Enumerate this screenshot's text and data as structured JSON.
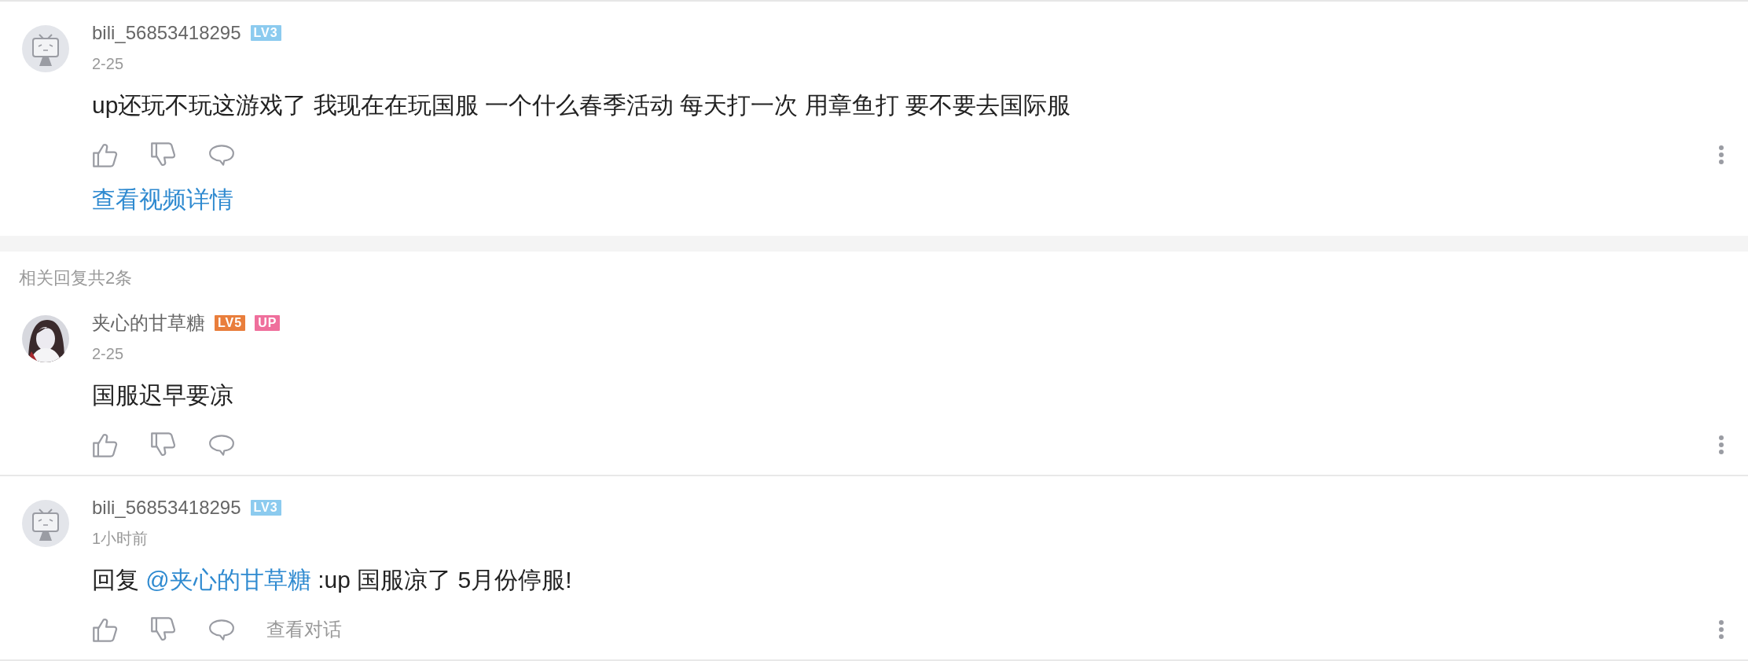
{
  "main_comment": {
    "avatar": {
      "kind": "default"
    },
    "user": "bili_56853418295",
    "badges": [
      {
        "text": "LV3",
        "color": "#8ccbef"
      }
    ],
    "date": "2-25",
    "text": "up还玩不玩这游戏了 我现在在玩国服 一个什么春季活动 每天打一次 用章鱼打 要不要去国际服",
    "link": "查看视频详情"
  },
  "replies_header": "相关回复共2条",
  "replies": [
    {
      "user": "夹心的甘草糖",
      "badges": [
        {
          "text": "LV5",
          "color": "#e97e3c"
        },
        {
          "text": "UP",
          "color": "#ef6f9c"
        }
      ],
      "date": "2-25",
      "text": "国服迟早要凉"
    },
    {
      "avatar": {
        "kind": "default"
      },
      "user": "bili_56853418295",
      "badges": [
        {
          "text": "LV3",
          "color": "#8ccbef"
        }
      ],
      "date": "1小时前",
      "reply_prefix": "回复",
      "mention": "@夹心的甘草糖",
      "text": ":up 国服凉了 5月份停服!",
      "action_link": "查看对话"
    }
  ]
}
